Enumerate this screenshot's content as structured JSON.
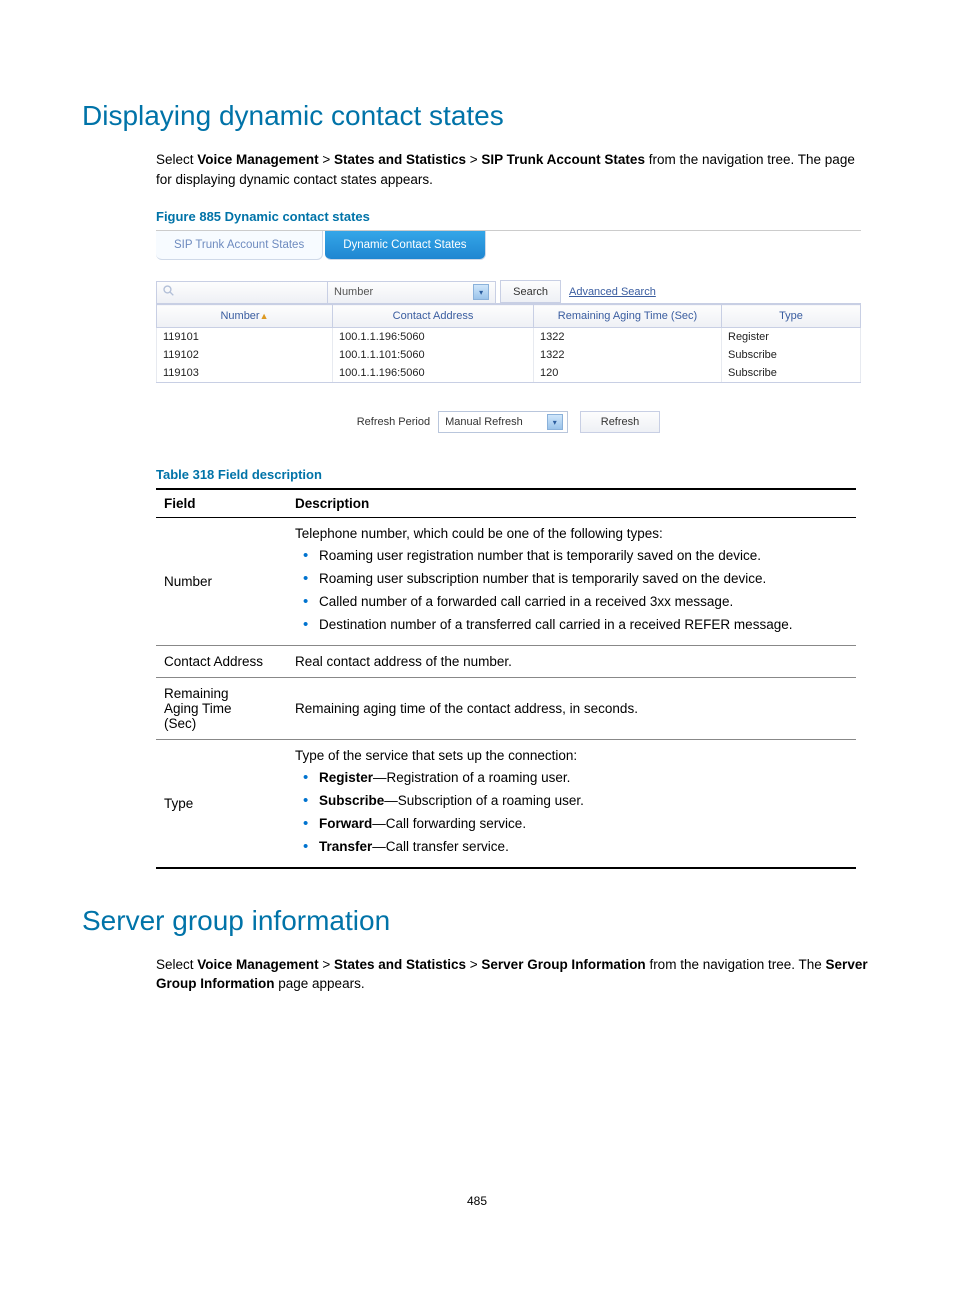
{
  "heading1": "Displaying dynamic contact states",
  "intro1_prefix": "Select ",
  "nav1_a": "Voice Management",
  "nav1_b": "States and Statistics",
  "nav1_c": "SIP Trunk Account States",
  "intro1_suffix": " from the navigation tree. The page for displaying dynamic contact states appears.",
  "figure_caption": "Figure 885 Dynamic contact states",
  "tabs": {
    "inactive": "SIP Trunk Account States",
    "active": "Dynamic Contact States"
  },
  "search": {
    "field": "Number",
    "button": "Search",
    "advanced": "Advanced Search"
  },
  "grid_headers": {
    "number": "Number",
    "contact": "Contact Address",
    "aging": "Remaining Aging Time (Sec)",
    "type": "Type"
  },
  "grid_rows": [
    {
      "number": "119101",
      "contact": "100.1.1.196:5060",
      "aging": "1322",
      "type": "Register"
    },
    {
      "number": "119102",
      "contact": "100.1.1.101:5060",
      "aging": "1322",
      "type": "Subscribe"
    },
    {
      "number": "119103",
      "contact": "100.1.1.196:5060",
      "aging": "120",
      "type": "Subscribe"
    }
  ],
  "refresh_label": "Refresh Period",
  "refresh_value": "Manual Refresh",
  "refresh_button": "Refresh",
  "table_caption": "Table 318 Field description",
  "th_field": "Field",
  "th_desc": "Description",
  "desc_rows": {
    "number_field": "Number",
    "number_intro": "Telephone number, which could be one of the following types:",
    "number_b1": "Roaming user registration number that is temporarily saved on the device.",
    "number_b2": "Roaming user subscription number that is temporarily saved on the device.",
    "number_b3": "Called number of a forwarded call carried in a received 3xx message.",
    "number_b4": "Destination number of a transferred call carried in a received REFER message.",
    "contact_field": "Contact Address",
    "contact_desc": "Real contact address of the number.",
    "aging_field_l1": "Remaining",
    "aging_field_l2": "Aging Time",
    "aging_field_l3": "(Sec)",
    "aging_desc": "Remaining aging time of the contact address, in seconds.",
    "type_field": "Type",
    "type_intro": "Type of the service that sets up the connection:",
    "type_b1_strong": "Register",
    "type_b1_rest": "—Registration of a roaming user.",
    "type_b2_strong": "Subscribe",
    "type_b2_rest": "—Subscription of a roaming user.",
    "type_b3_strong": "Forward",
    "type_b3_rest": "—Call forwarding service.",
    "type_b4_strong": "Transfer",
    "type_b4_rest": "—Call transfer service."
  },
  "heading2": "Server group information",
  "intro2_prefix": "Select ",
  "nav2_a": "Voice Management",
  "nav2_b": "States and Statistics",
  "nav2_c": "Server Group Information",
  "intro2_mid": " from the navigation tree. The ",
  "intro2_strong": "Server Group Information",
  "intro2_suffix": " page appears.",
  "page_number": "485"
}
